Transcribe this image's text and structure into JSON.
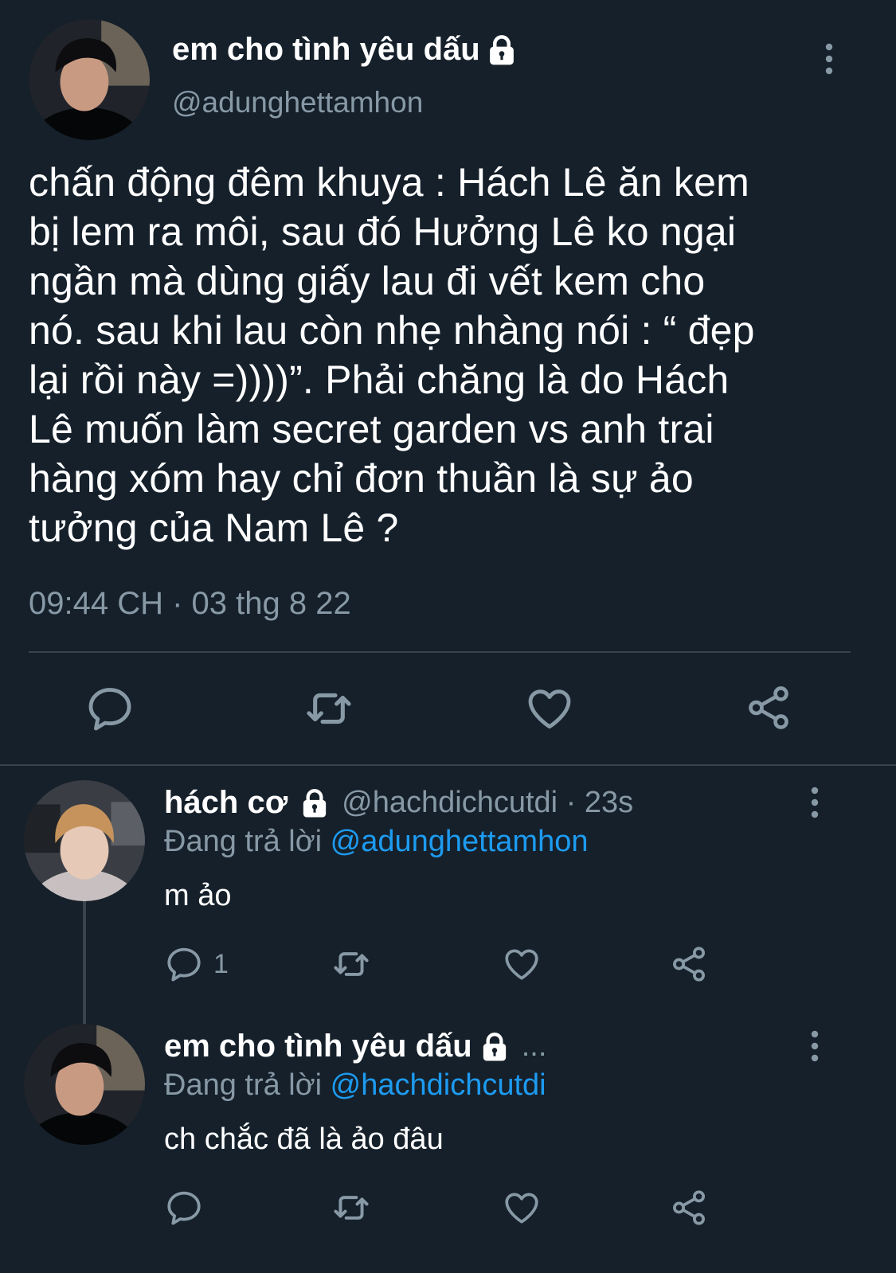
{
  "colors": {
    "background": "#15202b",
    "text_primary": "#ffffff",
    "text_secondary": "#8899a6",
    "link": "#1d9bf0",
    "divider": "#38444d"
  },
  "main_tweet": {
    "display_name": "em cho tình yêu dấu",
    "protected_icon": "lock-icon",
    "handle": "@adunghettamhon",
    "text": "chấn động đêm khuya : Hách Lê ăn kem\nbị lem ra môi, sau đó Hưởng Lê ko ngại\nngần mà dùng giấy lau đi vết kem cho\nnó. sau khi lau còn nhẹ nhàng nói : “ đẹp\nlại rồi này =))))”. Phải chăng là do Hách\nLê muốn làm secret garden vs anh trai\nhàng xóm hay chỉ đơn thuần là sự ảo\ntưởng của Nam Lê ?",
    "timestamp": "09:44 CH · 03 thg 8 22",
    "actions": [
      "reply-icon",
      "retweet-icon",
      "like-icon",
      "share-icon"
    ]
  },
  "replies": [
    {
      "display_name": "hách cơ",
      "protected_icon": "lock-icon",
      "handle_time": "@hachdichcutdi · 23s",
      "replying_prefix": "Đang trả lời",
      "replying_to": "@adunghettamhon",
      "text": "m ảo",
      "reply_count": "1"
    },
    {
      "display_name": "em cho tình yêu dấu",
      "protected_icon": "lock-icon",
      "truncation": "...",
      "replying_prefix": "Đang trả lời",
      "replying_to": "@hachdichcutdi",
      "text": "ch chắc đã là ảo đâu"
    }
  ]
}
